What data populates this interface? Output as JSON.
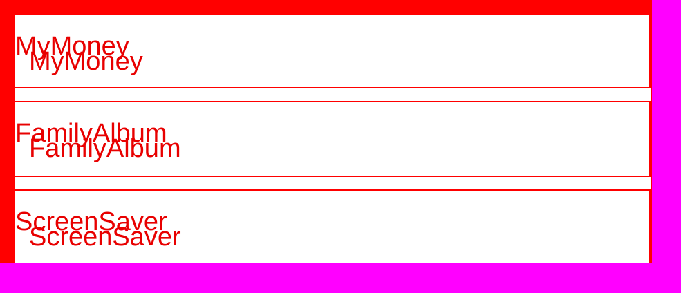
{
  "apps": [
    {
      "name": "MyMoney",
      "shadow_label": "MyMoney"
    },
    {
      "name": "FamilyAlbum",
      "shadow_label": "FamilyAlbum"
    },
    {
      "name": "ScreenSaver",
      "shadow_label": "ScreenSaver"
    }
  ],
  "colors": {
    "frame": "#ff0000",
    "backdrop": "#ff00ff",
    "panel": "#ffffff",
    "text": "#e80000"
  }
}
